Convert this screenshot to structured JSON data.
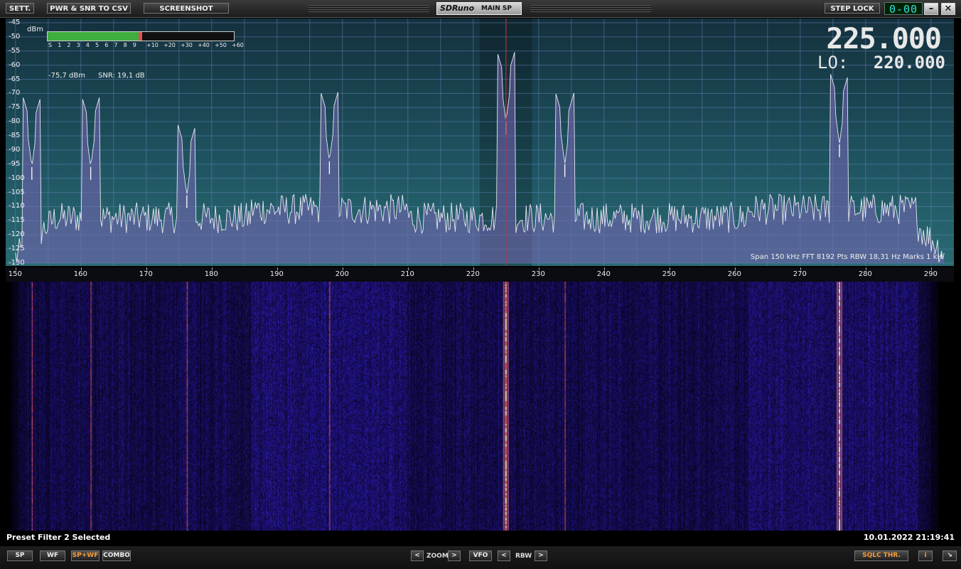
{
  "titlebar": {
    "sett_label": "SETT.",
    "pwr_label": "PWR & SNR TO CSV",
    "screenshot_label": "SCREENSHOT",
    "brand": "SDRuno",
    "window_name": "MAIN SP",
    "steplock_label": "STEP LOCK",
    "seg_display": "0-00",
    "minimize_glyph": "–",
    "close_glyph": "✕"
  },
  "spectrum": {
    "dbm_unit": "dBm",
    "meter_scale": [
      "S",
      "1",
      "2",
      "3",
      "4",
      "5",
      "6",
      "7",
      "8",
      "9",
      "+10",
      "+20",
      "+30",
      "+40",
      "+50",
      "+60"
    ],
    "meter_level_fraction": 0.5,
    "power_readout": "-75,7 dBm",
    "snr_readout": "SNR: 19,1 dB",
    "frequency": "225.000",
    "lo_label": "LO:",
    "lo_value": "220.000",
    "info_line": "Span 150 kHz   FFT 8192 Pts   RBW 18,31 Hz   Marks 1 kH"
  },
  "chart_data": {
    "type": "line",
    "y_ticks": [
      "-45",
      "-50",
      "-55",
      "-60",
      "-65",
      "-70",
      "-75",
      "-80",
      "-85",
      "-90",
      "-95",
      "-100",
      "-105",
      "-110",
      "-115",
      "-120",
      "-125",
      "-130"
    ],
    "ylim": [
      -130,
      -45
    ],
    "x_ticks": [
      "150",
      "160",
      "170",
      "180",
      "190",
      "200",
      "210",
      "220",
      "230",
      "240",
      "250",
      "260",
      "270",
      "280",
      "290"
    ],
    "xlim": [
      148.5,
      293.5
    ],
    "tuned_khz": 225,
    "peaks": [
      {
        "x": 152.5,
        "y": -96
      },
      {
        "x": 161.5,
        "y": -96
      },
      {
        "x": 176.2,
        "y": -106
      },
      {
        "x": 198,
        "y": -94
      },
      {
        "x": 225,
        "y": -80
      },
      {
        "x": 234,
        "y": -95
      },
      {
        "x": 276,
        "y": -88
      }
    ]
  },
  "status": {
    "left_message": "Preset Filter 2 Selected",
    "datetime": "10.01.2022 21:19:41"
  },
  "bottombar": {
    "sp_label": "SP",
    "wf_label": "WF",
    "spwf_label": "SP+WF",
    "combo_label": "COMBO",
    "zoom_label": "ZOOM",
    "vfo_label": "VFO",
    "rbw_label": "RBW",
    "left_arrow": "<",
    "right_arrow": ">",
    "sqlc_label": "SQLC THR.",
    "info_label": "i",
    "resize_glyph": "↘"
  }
}
